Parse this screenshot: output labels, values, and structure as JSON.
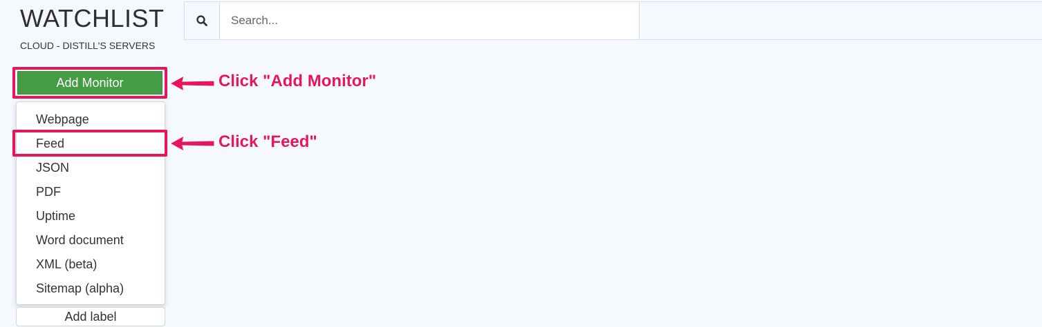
{
  "header": {
    "title": "WATCHLIST",
    "subtitle": "CLOUD - DISTILL'S SERVERS"
  },
  "search": {
    "icon": "search-icon",
    "placeholder": "Search..."
  },
  "toolbar": {
    "add_monitor_label": "Add Monitor"
  },
  "monitor_menu": {
    "items": [
      {
        "label": "Webpage"
      },
      {
        "label": "Feed"
      },
      {
        "label": "JSON"
      },
      {
        "label": "PDF"
      },
      {
        "label": "Uptime"
      },
      {
        "label": "Word document"
      },
      {
        "label": "XML (beta)"
      },
      {
        "label": "Sitemap (alpha)"
      }
    ]
  },
  "labels": {
    "add_label": "Add label"
  },
  "annotations": {
    "step1": "Click \"Add Monitor\"",
    "step2": "Click \"Feed\"",
    "color": "#e8155b"
  }
}
